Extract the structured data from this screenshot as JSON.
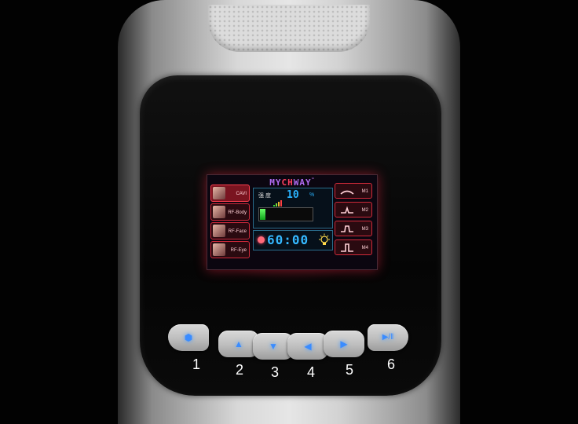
{
  "display": {
    "brand": {
      "prefix": "MY",
      "highlight": "CH",
      "suffix": "WAY",
      "tm": "™"
    },
    "modes": [
      {
        "label": "CAVI",
        "active": true
      },
      {
        "label": "RF-Body",
        "active": false
      },
      {
        "label": "RF-Face",
        "active": false
      },
      {
        "label": "RF-Eye",
        "active": false
      }
    ],
    "intensity": {
      "label": "强 度",
      "value": "10",
      "unit": "%",
      "level_fraction": 0.1
    },
    "timer": {
      "value": "60:00"
    },
    "presets": [
      {
        "label": "M1"
      },
      {
        "label": "M2"
      },
      {
        "label": "M3"
      },
      {
        "label": "M4"
      }
    ]
  },
  "controls": {
    "buttons": [
      {
        "number": "1",
        "icon": "hexagon-icon",
        "glyph": "⬢"
      },
      {
        "number": "2",
        "icon": "up-arrow-icon",
        "glyph": "▲"
      },
      {
        "number": "3",
        "icon": "down-arrow-icon",
        "glyph": "▼"
      },
      {
        "number": "4",
        "icon": "left-arrow-icon",
        "glyph": "◀"
      },
      {
        "number": "5",
        "icon": "right-arrow-icon",
        "glyph": "▶"
      },
      {
        "number": "6",
        "icon": "play-pause-icon",
        "glyph": "▶/‖"
      }
    ]
  },
  "colors": {
    "accent_red": "#ff4050",
    "lcd_blue": "#2ab3ff",
    "button_blue": "#3a8cff",
    "brand_purple": "#b06af0"
  }
}
